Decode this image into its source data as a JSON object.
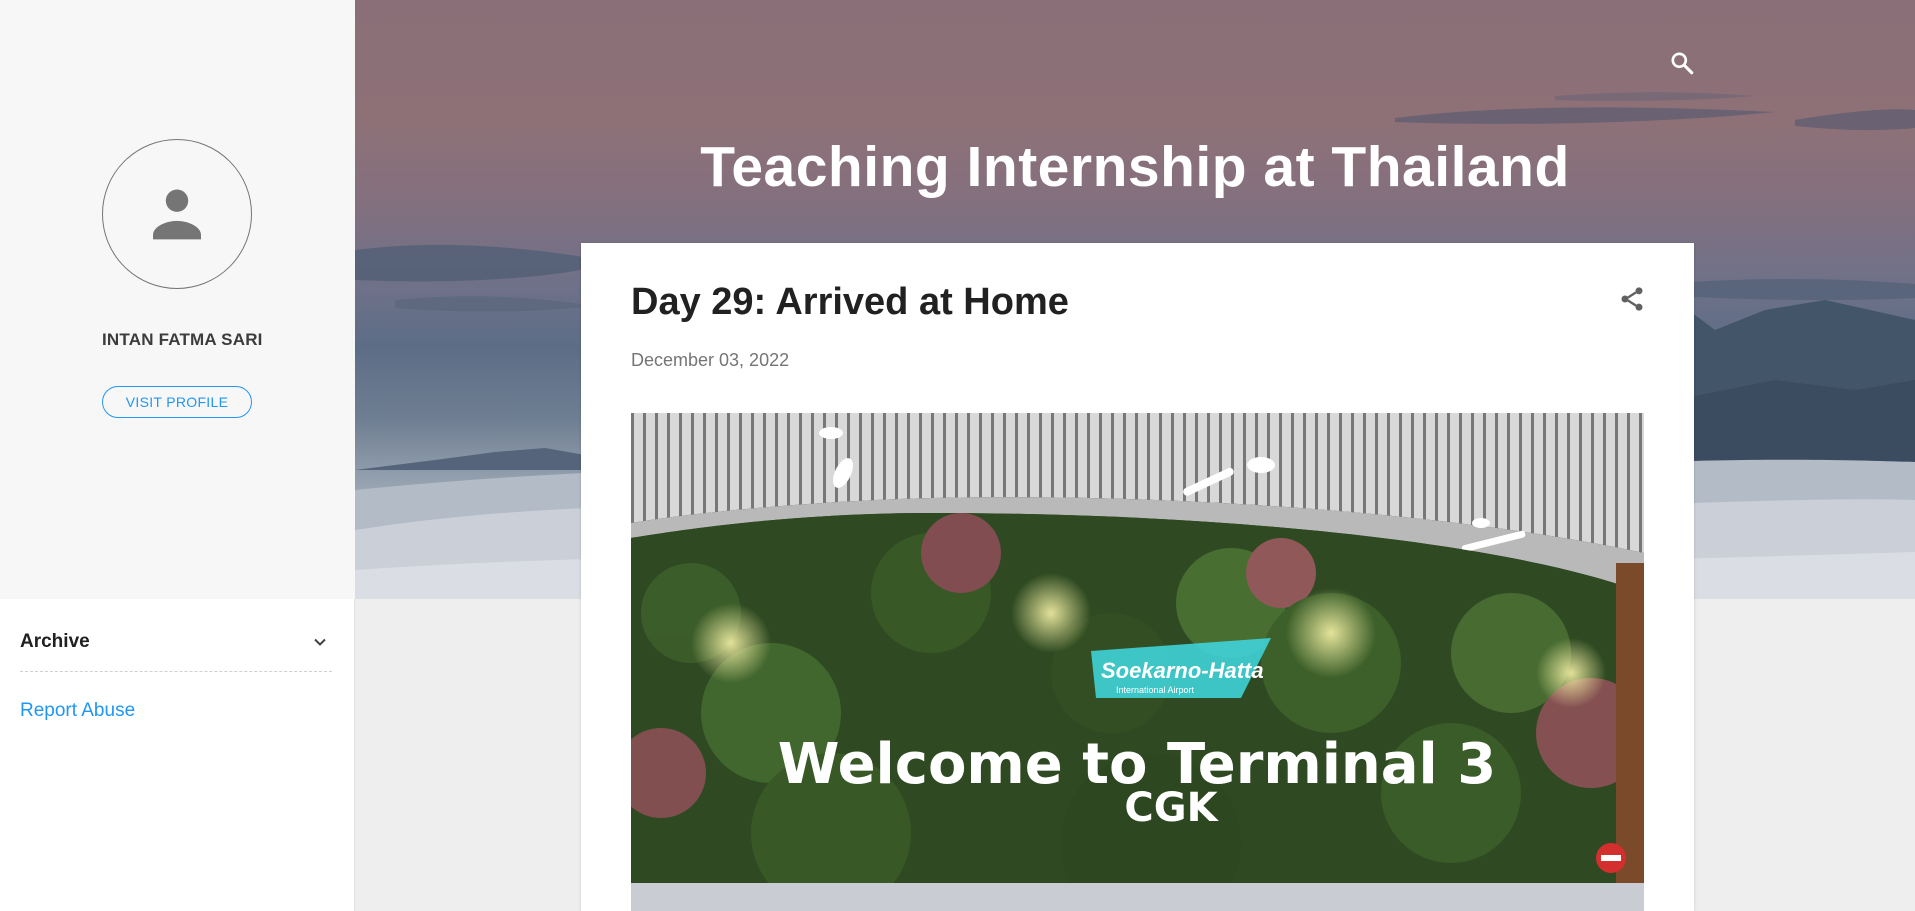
{
  "header": {
    "blog_title": "Teaching Internship at Thailand",
    "search_icon": "search-icon"
  },
  "sidebar": {
    "profile_name": "INTAN FATMA SARI",
    "visit_profile_label": "VISIT PROFILE",
    "archive_label": "Archive",
    "report_abuse_label": "Report Abuse"
  },
  "post": {
    "title": "Day 29: Arrived at Home",
    "date": "December 03, 2022",
    "share_icon": "share-icon",
    "image": {
      "sign_brand": "Soekarno-Hatta",
      "sign_subtitle": "International Airport",
      "welcome_text": "Welcome to Terminal 3",
      "code_text": "CGK"
    }
  },
  "colors": {
    "accent": "#2196f3",
    "sidebar_bg": "#f7f7f7",
    "page_bg": "#eeeeee",
    "title_text": "#212121",
    "meta_text": "#757575"
  }
}
